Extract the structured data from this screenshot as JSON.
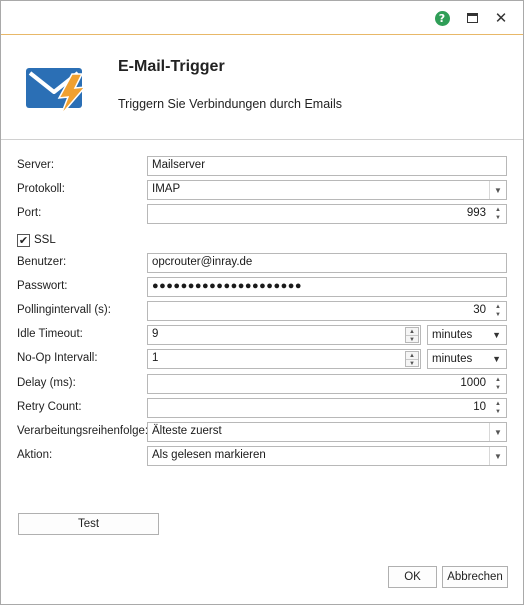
{
  "window": {
    "help_symbol": "?",
    "close_symbol": "✕"
  },
  "header": {
    "title": "E-Mail-Trigger",
    "subtitle": "Triggern Sie Verbindungen durch Emails",
    "icon": "email-lightning-icon"
  },
  "form": {
    "server": {
      "label": "Server:",
      "value": "Mailserver"
    },
    "protocol": {
      "label": "Protokoll:",
      "value": "IMAP"
    },
    "port": {
      "label": "Port:",
      "value": "993"
    },
    "ssl": {
      "label": "SSL",
      "checked": true,
      "check_symbol": "✔"
    },
    "user": {
      "label": "Benutzer:",
      "value": "opcrouter@inray.de"
    },
    "password": {
      "label": "Passwort:",
      "value": "●●●●●●●●●●●●●●●●●●●●●"
    },
    "polling": {
      "label": "Pollingintervall (s):",
      "value": "30"
    },
    "idle_timeout": {
      "label": "Idle Timeout:",
      "value": "9",
      "unit": "minutes"
    },
    "noop_interval": {
      "label": "No-Op Intervall:",
      "value": "1",
      "unit": "minutes"
    },
    "delay": {
      "label": "Delay (ms):",
      "value": "1000"
    },
    "retry": {
      "label": "Retry Count:",
      "value": "10"
    },
    "order": {
      "label": "Verarbeitungsreihenfolge:",
      "value": "Älteste zuerst"
    },
    "action": {
      "label": "Aktion:",
      "value": "Als gelesen markieren"
    }
  },
  "buttons": {
    "test": "Test",
    "ok": "OK",
    "cancel": "Abbrechen"
  },
  "colors": {
    "accent_border": "#e8b868",
    "help_green": "#2f9e57",
    "envelope_blue": "#2b6fb5",
    "lightning_orange": "#f0a030"
  }
}
